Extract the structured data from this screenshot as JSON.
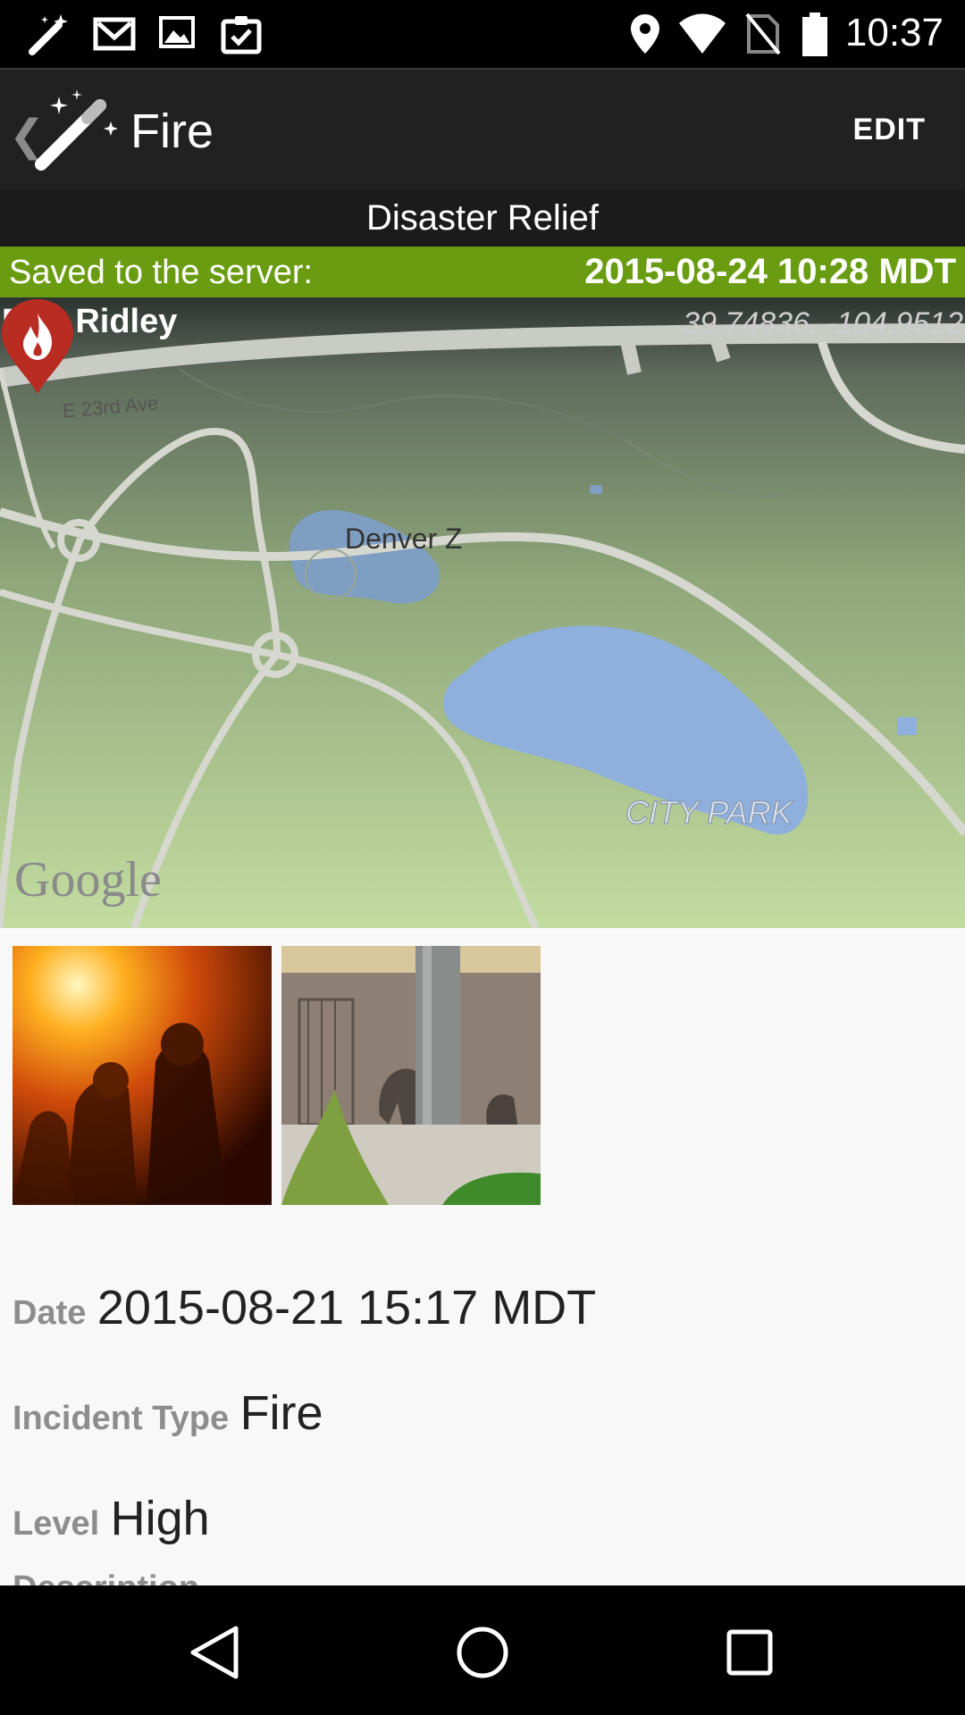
{
  "status_bar": {
    "time": "10:37",
    "left_icons": [
      "magic-wand-icon",
      "gmail-icon",
      "image-icon",
      "clipboard-check-icon"
    ],
    "right_icons": [
      "location-icon",
      "wifi-icon",
      "no-sim-icon",
      "battery-icon"
    ]
  },
  "action_bar": {
    "title": "Fire",
    "edit_label": "EDIT",
    "back_icon": "chevron-left-icon",
    "app_icon": "magic-wand-icon"
  },
  "subheader": {
    "group": "Disaster Relief"
  },
  "saved": {
    "label": "Saved to the server:",
    "timestamp": "2015-08-24 10:28 MDT",
    "color": "#6a9c12"
  },
  "map": {
    "reporter": "Dan Ridley",
    "coordinates": "39.74836, -104.9512",
    "street_label": "E 23rd Ave",
    "poi_label": "Denver Z",
    "park_label": "CITY PARK",
    "attribution": "Google",
    "marker_icon": "fire-marker-icon"
  },
  "photos": [
    {
      "name": "firefighters-photo"
    },
    {
      "name": "elephants-photo"
    }
  ],
  "fields": [
    {
      "label": "Date",
      "value": "2015-08-21 15:17 MDT"
    },
    {
      "label": "Incident Type",
      "value": "Fire"
    },
    {
      "label": "Level",
      "value": "High"
    },
    {
      "label": "Description",
      "value": ""
    }
  ],
  "nav_bar": {
    "icons": [
      "back-triangle-icon",
      "home-circle-icon",
      "recents-square-icon"
    ]
  }
}
